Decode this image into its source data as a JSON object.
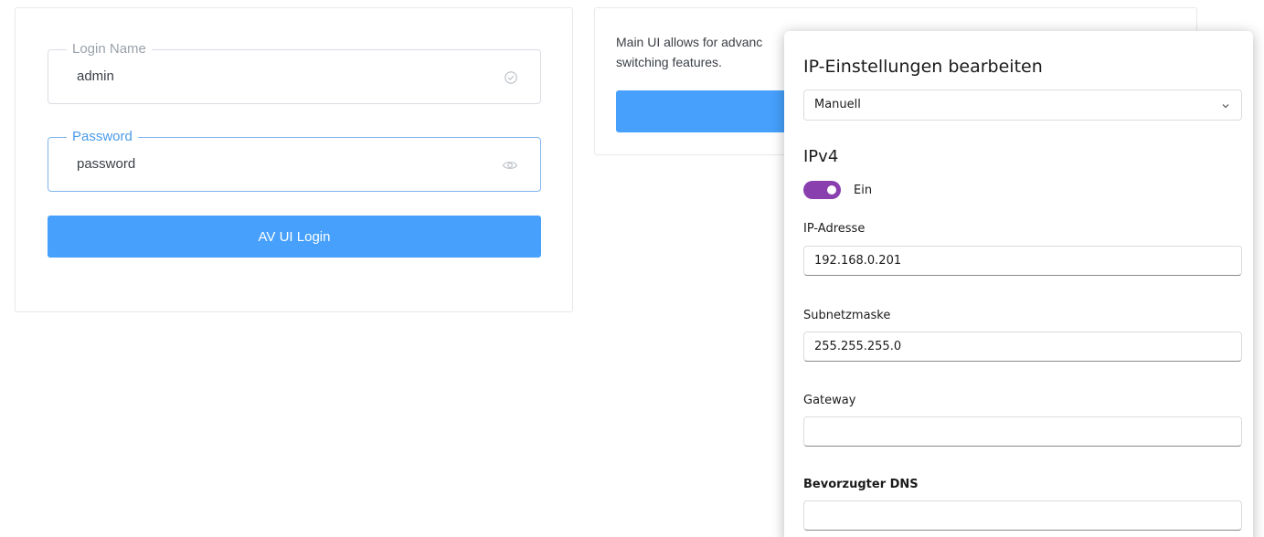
{
  "login": {
    "login_name_label": "Login Name",
    "login_name_value": "admin",
    "password_label": "Password",
    "password_value": "password",
    "login_button": "AV UI Login"
  },
  "main_ui": {
    "description": "Main UI allows for advanc switching features."
  },
  "ip_settings": {
    "title": "IP-Einstellungen bearbeiten",
    "mode_selected": "Manuell",
    "ipv4_heading": "IPv4",
    "ipv4_toggle_state": "Ein",
    "ipv4_enabled": true,
    "fields": [
      {
        "label": "IP-Adresse",
        "value": "192.168.0.201"
      },
      {
        "label": "Subnetzmaske",
        "value": "255.255.255.0"
      },
      {
        "label": "Gateway",
        "value": ""
      },
      {
        "label": "Bevorzugter DNS",
        "value": ""
      }
    ],
    "accent_color": "#8a3fae"
  },
  "colors": {
    "primary_button": "#46a0fc",
    "focus_border": "#7fb4ee"
  }
}
